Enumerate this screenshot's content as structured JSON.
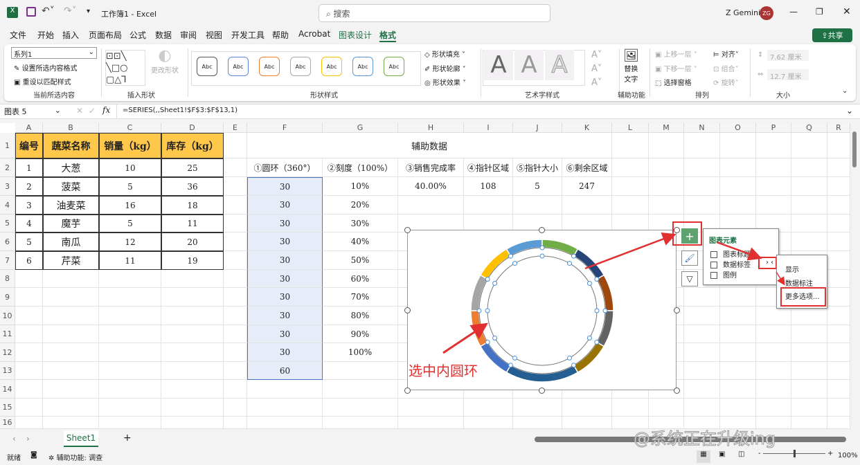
{
  "titlebar": {
    "title": "工作簿1 - Excel",
    "search_placeholder": "搜索",
    "user": "Z Gemini",
    "avatar": "ZG",
    "share": "共享"
  },
  "menu": [
    "文件",
    "开始",
    "插入",
    "页面布局",
    "公式",
    "数据",
    "审阅",
    "视图",
    "开发工具",
    "帮助",
    "Acrobat",
    "图表设计",
    "格式"
  ],
  "ribbon": {
    "current": {
      "selector": "系列1",
      "format_sel": "设置所选内容格式",
      "reset": "重设以匹配样式",
      "label": "当前所选内容"
    },
    "insert_shapes": {
      "change": "更改形状",
      "label": "插入形状"
    },
    "shape_styles": {
      "sample": "Abc",
      "fill": "形状填充",
      "outline": "形状轮廓",
      "effect": "形状效果",
      "label": "形状样式"
    },
    "wordart": {
      "label": "艺术字样式",
      "glyph": "A"
    },
    "access": {
      "alt": "替换",
      "alt2": "文字",
      "label": "辅助功能"
    },
    "arrange": {
      "up": "上移一层",
      "down": "下移一层",
      "pane": "选择窗格",
      "align": "对齐",
      "group": "组合",
      "rotate": "旋转",
      "label": "排列"
    },
    "size": {
      "height": "7.62 厘米",
      "width": "12.7 厘米",
      "label": "大小"
    }
  },
  "formula": {
    "name_box": "图表 5",
    "fx": "fx",
    "value": "=SERIES(,,Sheet1!$F$3:$F$13,1)"
  },
  "sheet": {
    "columns": [
      "A",
      "B",
      "C",
      "D",
      "E",
      "F",
      "G",
      "H",
      "I",
      "J",
      "K",
      "L",
      "M",
      "N",
      "O",
      "P",
      "Q",
      "R"
    ],
    "rows": [
      "1",
      "2",
      "3",
      "4",
      "5",
      "6",
      "7",
      "8",
      "9",
      "10",
      "11",
      "12",
      "13",
      "14",
      "15",
      "16"
    ],
    "table_header": [
      "编号",
      "蔬菜名称",
      "销量（kg）",
      "库存（kg）"
    ],
    "table": [
      [
        "1",
        "大葱",
        "10",
        "25"
      ],
      [
        "2",
        "菠菜",
        "5",
        "36"
      ],
      [
        "3",
        "油麦菜",
        "16",
        "18"
      ],
      [
        "4",
        "魔芋",
        "5",
        "11"
      ],
      [
        "5",
        "南瓜",
        "12",
        "20"
      ],
      [
        "6",
        "芹菜",
        "11",
        "19"
      ]
    ],
    "aux_title": "辅助数据",
    "aux_header": [
      "①圆环（360°）",
      "②刻度（100%）",
      "③销售完成率",
      "④指针区域",
      "⑤指针大小",
      "⑥剩余区域"
    ],
    "aux_row3": [
      "40.00%",
      "108",
      "5",
      "247"
    ],
    "col_f": [
      "30",
      "30",
      "30",
      "30",
      "30",
      "30",
      "30",
      "30",
      "30",
      "30",
      "60"
    ],
    "col_g": [
      "10%",
      "20%",
      "30%",
      "40%",
      "50%",
      "60%",
      "70%",
      "80%",
      "90%",
      "100%"
    ]
  },
  "chart": {
    "values": [
      30,
      30,
      30,
      30,
      30,
      30,
      30,
      30,
      30,
      30,
      60
    ],
    "colors": [
      "#4472C4",
      "#ED7D31",
      "#A5A5A5",
      "#FFC000",
      "#5B9BD5",
      "#70AD47",
      "#264478",
      "#9E480E",
      "#636363",
      "#997300",
      "#255E91"
    ],
    "annotation": "选中内圆环"
  },
  "popup": {
    "title": "图表元素",
    "items": [
      "图表标题",
      "数据标签",
      "图例"
    ],
    "sub": [
      "显示",
      "数据标注",
      "更多选项..."
    ]
  },
  "tabs": {
    "sheet": "Sheet1",
    "add": "+"
  },
  "status": {
    "ready": "就绪",
    "access": "辅助功能: 调查",
    "zoom": "100%"
  },
  "watermark": "@系统正在升级ing"
}
